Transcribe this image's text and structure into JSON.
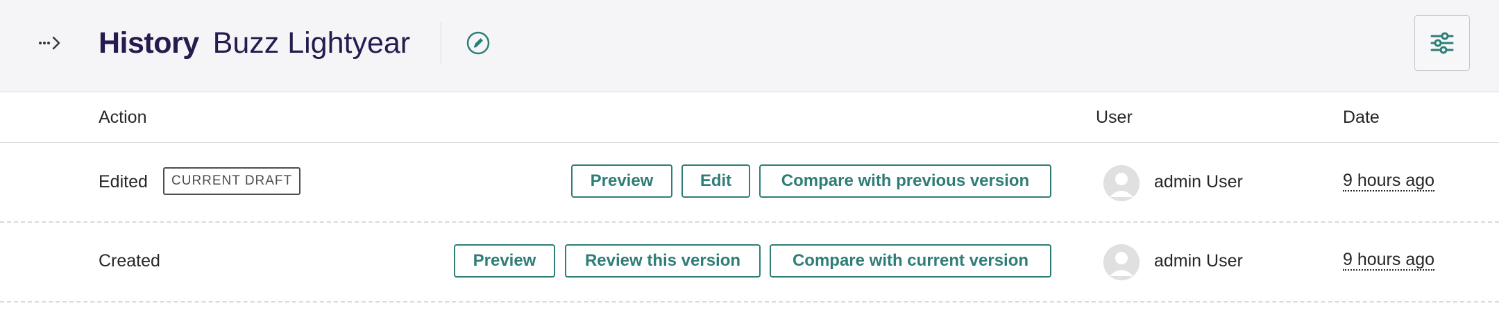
{
  "header": {
    "title": "History",
    "subtitle": "Buzz Lightyear"
  },
  "icons": {
    "breadcrumb": "ellipsis-arrow-right-icon",
    "edit": "pencil-circle-icon",
    "filters": "sliders-icon"
  },
  "table": {
    "columns": {
      "action": "Action",
      "user": "User",
      "date": "Date"
    },
    "rows": [
      {
        "action": "Edited",
        "badge": "CURRENT DRAFT",
        "buttons": [
          "Preview",
          "Edit",
          "Compare with previous version"
        ],
        "user": "admin User",
        "date": "9 hours ago"
      },
      {
        "action": "Created",
        "badge": "",
        "buttons": [
          "Preview",
          "Review this version",
          "Compare with current version"
        ],
        "user": "admin User",
        "date": "9 hours ago"
      }
    ]
  },
  "colors": {
    "accent": "#2e7d77",
    "title": "#261a4f",
    "header_bg": "#f5f5f7"
  }
}
